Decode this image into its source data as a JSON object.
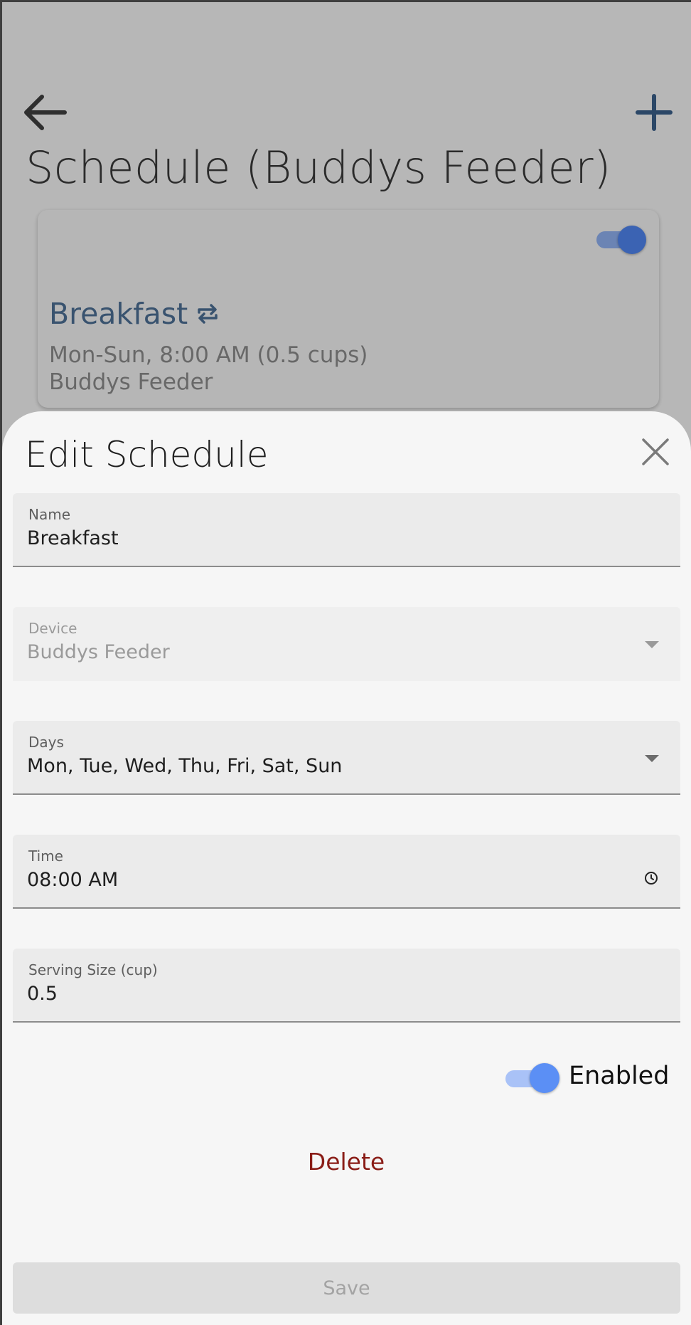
{
  "background": {
    "title": "Schedule (Buddys Feeder)",
    "card": {
      "name": "Breakfast",
      "summary": "Mon-Sun, 8:00 AM (0.5 cups)",
      "device": "Buddys Feeder",
      "enabled": true
    },
    "icons": {
      "back": "arrow-left-icon",
      "add": "plus-icon",
      "repeat": "repeat-icon"
    }
  },
  "sheet": {
    "title": "Edit Schedule",
    "fields": {
      "name": {
        "label": "Name",
        "value": "Breakfast"
      },
      "device": {
        "label": "Device",
        "value": "Buddys Feeder",
        "disabled": true
      },
      "days": {
        "label": "Days",
        "value": "Mon, Tue, Wed, Thu, Fri, Sat, Sun"
      },
      "time": {
        "label": "Time",
        "value": "08:00 AM"
      },
      "serving": {
        "label": "Serving Size (cup)",
        "value": "0.5"
      }
    },
    "enabled": {
      "label": "Enabled",
      "on": true
    },
    "delete_label": "Delete",
    "save_label": "Save",
    "save_disabled": true
  },
  "colors": {
    "accent": "#5b8ff5",
    "danger": "#8a1d17",
    "link": "#4d6f95"
  }
}
